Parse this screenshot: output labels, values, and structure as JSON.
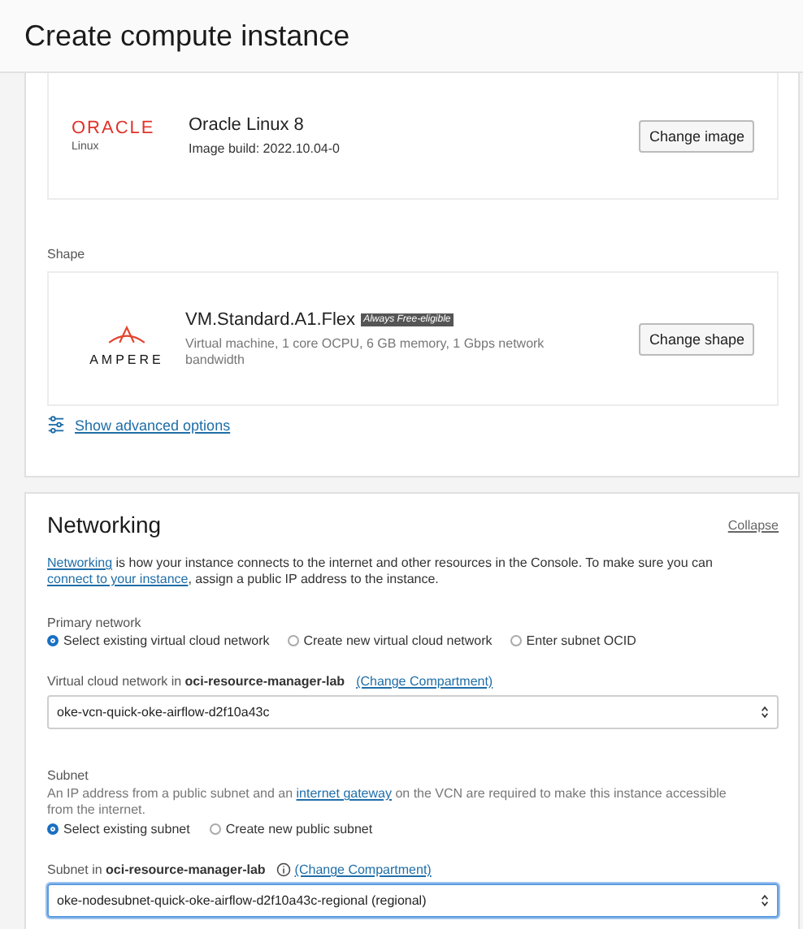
{
  "page_title": "Create compute instance",
  "image": {
    "logo_word": "ORACLE",
    "logo_sub": "Linux",
    "name": "Oracle Linux 8",
    "build": "Image build: 2022.10.04-0",
    "button": "Change image"
  },
  "shape": {
    "label": "Shape",
    "logo_word": "AMPERE",
    "name": "VM.Standard.A1.Flex",
    "badge": "Always Free-eligible",
    "description": "Virtual machine, 1 core OCPU, 6 GB memory, 1 Gbps network bandwidth",
    "button": "Change shape"
  },
  "advanced_link": "Show advanced options",
  "networking": {
    "title": "Networking",
    "collapse": "Collapse",
    "intro": [
      {
        "text": "Networking",
        "link": true
      },
      {
        "text": " is how your instance connects to the internet and other resources in the Console. To make sure you can ",
        "link": false
      },
      {
        "text": "connect to your instance",
        "link": true
      },
      {
        "text": ", assign a public IP address to the instance.",
        "link": false
      }
    ],
    "primary_label": "Primary network",
    "primary_options": [
      {
        "label": "Select existing virtual cloud network",
        "selected": true
      },
      {
        "label": "Create new virtual cloud network",
        "selected": false
      },
      {
        "label": "Enter subnet OCID",
        "selected": false
      }
    ],
    "vcn_label": "Virtual cloud network in",
    "vcn_compartment": "oci-resource-manager-lab",
    "vcn_change": "(Change Compartment)",
    "vcn_value": "oke-vcn-quick-oke-airflow-d2f10a43c",
    "vcn_focused": false,
    "subnet_label": "Subnet",
    "subnet_help": [
      {
        "text": "An IP address from a public subnet and an ",
        "link": false
      },
      {
        "text": "internet gateway",
        "link": true
      },
      {
        "text": " on the VCN are required to make this instance accessible from the internet.",
        "link": false
      }
    ],
    "subnet_options": [
      {
        "label": "Select existing subnet",
        "selected": true
      },
      {
        "label": "Create new public subnet",
        "selected": false
      }
    ],
    "subnet_in_label": "Subnet in",
    "subnet_compartment": "oci-resource-manager-lab",
    "subnet_change": "(Change Compartment)",
    "subnet_value": "oke-nodesubnet-quick-oke-airflow-d2f10a43c-regional (regional)",
    "subnet_focused": true
  }
}
